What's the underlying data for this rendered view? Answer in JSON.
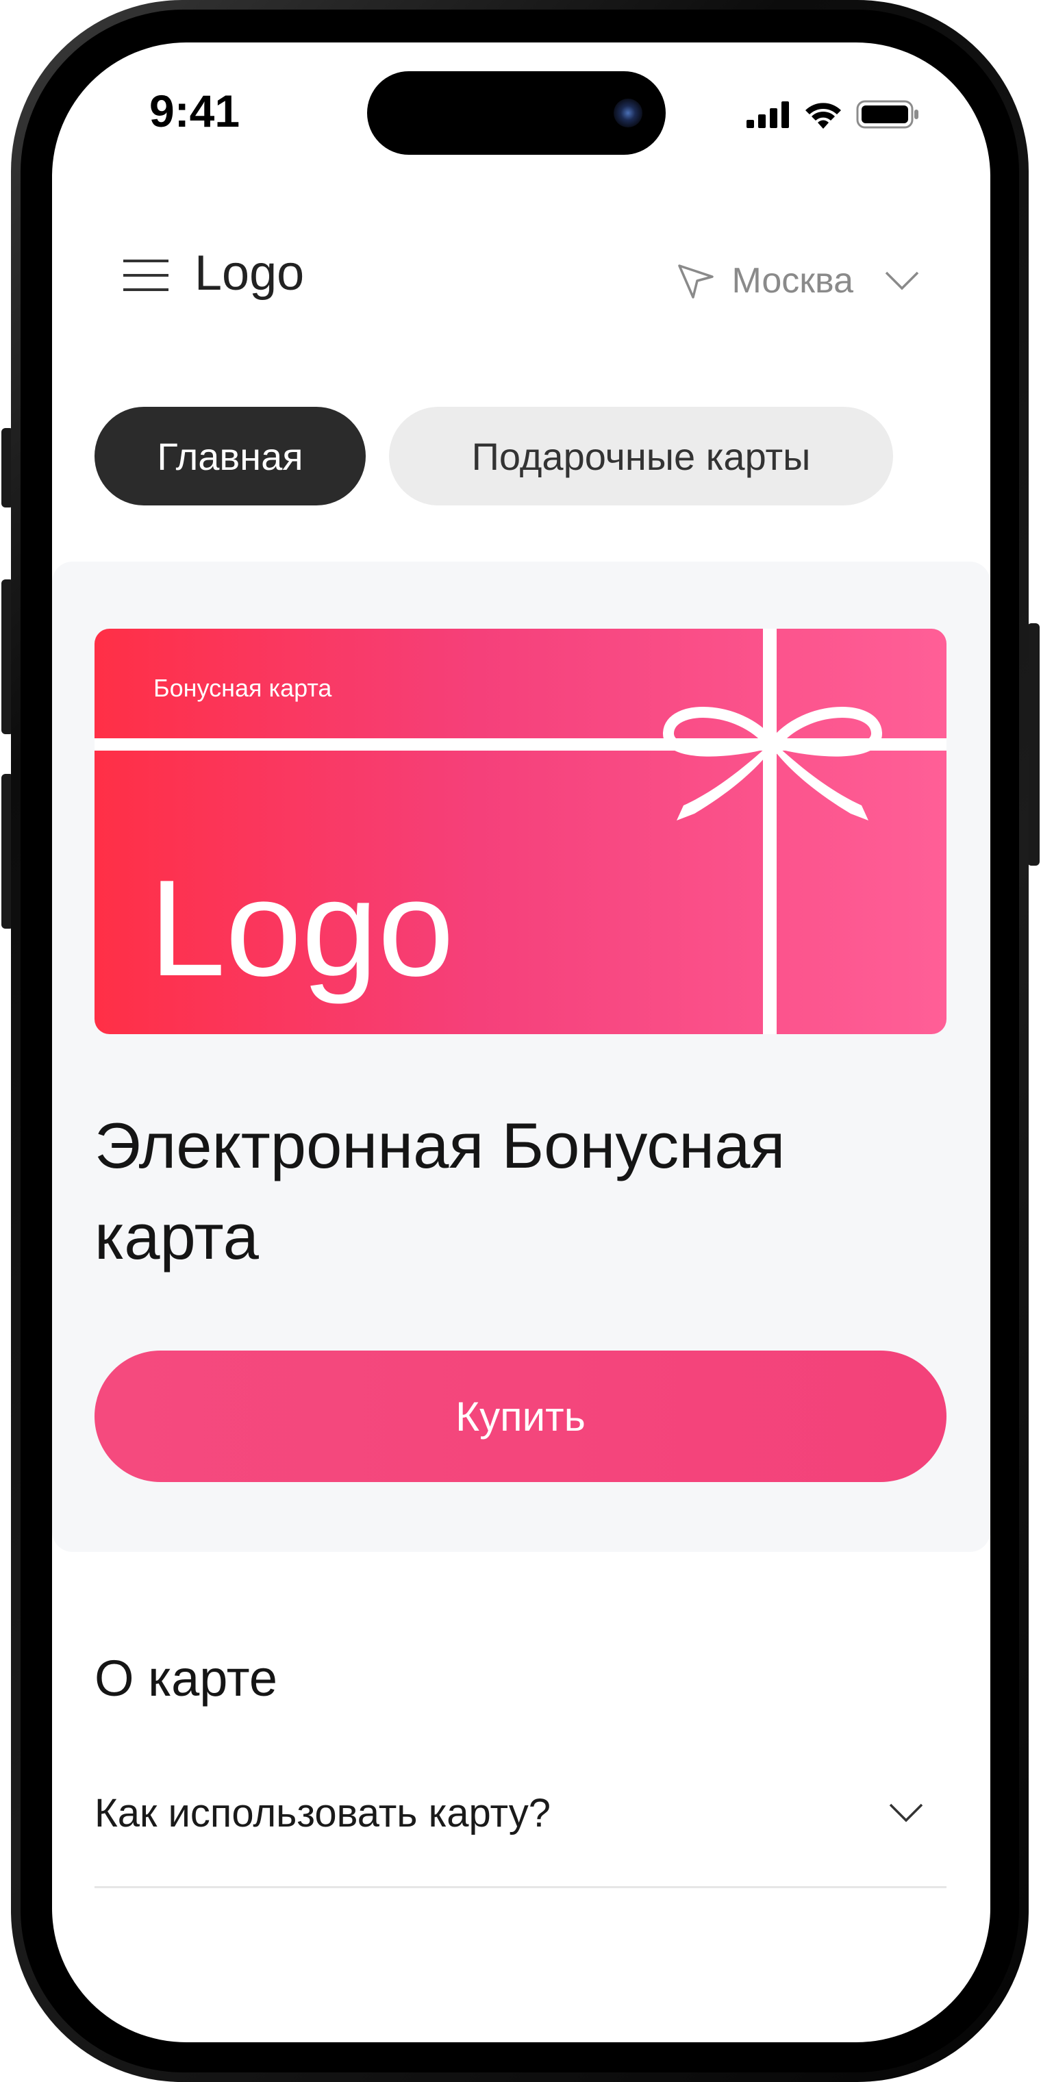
{
  "status_bar": {
    "time": "9:41"
  },
  "header": {
    "logo": "Logo",
    "city": "Москва"
  },
  "tabs": [
    {
      "label": "Главная",
      "active": true
    },
    {
      "label": "Подарочные карты",
      "active": false
    }
  ],
  "card": {
    "label": "Бонусная карта",
    "logo": "Logo"
  },
  "product": {
    "title": "Электронная Бонусная карта",
    "buy_label": "Купить"
  },
  "about": {
    "title": "О карте",
    "question": "Как использовать карту?"
  },
  "colors": {
    "accent": "#f3427a",
    "card_start": "#ff2f46",
    "card_end": "#ff5f97",
    "tab_active": "#2b2b2b"
  },
  "icons": [
    "menu-icon",
    "location-arrow-icon",
    "chevron-down-icon",
    "signal-icon",
    "wifi-icon",
    "battery-icon"
  ]
}
